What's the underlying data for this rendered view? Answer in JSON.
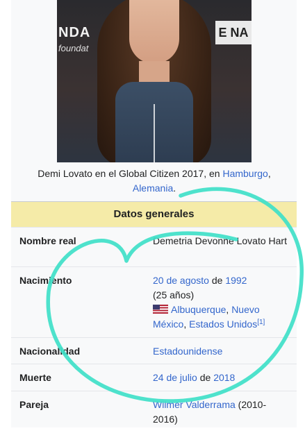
{
  "photo": {
    "sign_left": "NDA",
    "sign_left_sub": "foundat",
    "sign_right": "E NA"
  },
  "caption": {
    "text": "Demi Lovato en el Global Citizen 2017, en ",
    "link1": "Hamburgo",
    "sep": ",",
    "link2": "Alemania",
    "end": "."
  },
  "infobox": {
    "header": "Datos generales",
    "rows": [
      {
        "label": "Nombre real",
        "value": "Demetria Devonne Lovato Hart"
      },
      {
        "label": "Nacimiento",
        "date_link": "20 de agosto",
        "date_mid": " de ",
        "year_link": "1992",
        "age": "(25 años)",
        "place1": "Albuquerque",
        "place_sep": ", ",
        "place2": "Nuevo México",
        "place3": "Estados Unidos",
        "ref": "[1]"
      },
      {
        "label": "Nacionalidad",
        "value": "Estadounidense"
      },
      {
        "label": "Muerte",
        "date_link": "24 de julio",
        "date_mid": " de ",
        "year_link": "2018"
      },
      {
        "label": "Pareja",
        "value_link": "Wilmer Valderrama",
        "value_rest": " (2010-2016)"
      }
    ]
  },
  "colors": {
    "link": "#3366cc",
    "header_bg": "#f5eba8",
    "annotation": "#3fe0c8"
  }
}
